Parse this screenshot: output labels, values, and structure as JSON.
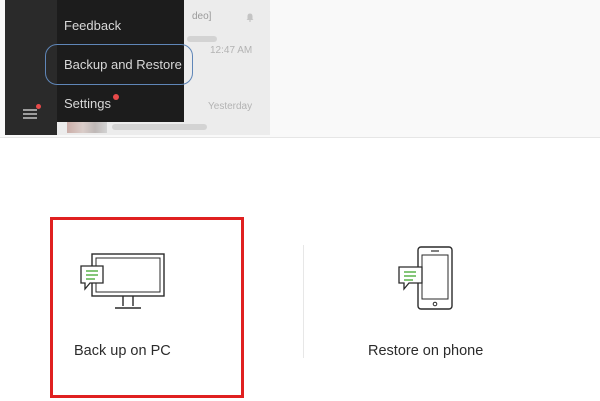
{
  "menu": {
    "items": [
      {
        "label": "Feedback"
      },
      {
        "label": "Backup and Restore"
      },
      {
        "label": "Settings"
      }
    ]
  },
  "chat_list": {
    "rows": [
      {
        "snippet": "deo]",
        "time": ""
      },
      {
        "snippet": "",
        "time": "12:47 AM"
      },
      {
        "snippet": "",
        "time": "Yesterday"
      }
    ]
  },
  "options": {
    "backup": {
      "label": "Back up on PC",
      "icon": "monitor-with-chat-icon"
    },
    "restore": {
      "label": "Restore on phone",
      "icon": "phone-with-chat-icon"
    }
  },
  "colors": {
    "highlight": "#e02020",
    "chat_bubble_green": "#5bb24a",
    "selection_outline": "#5f86b8",
    "notification_dot": "#e84a4a"
  }
}
